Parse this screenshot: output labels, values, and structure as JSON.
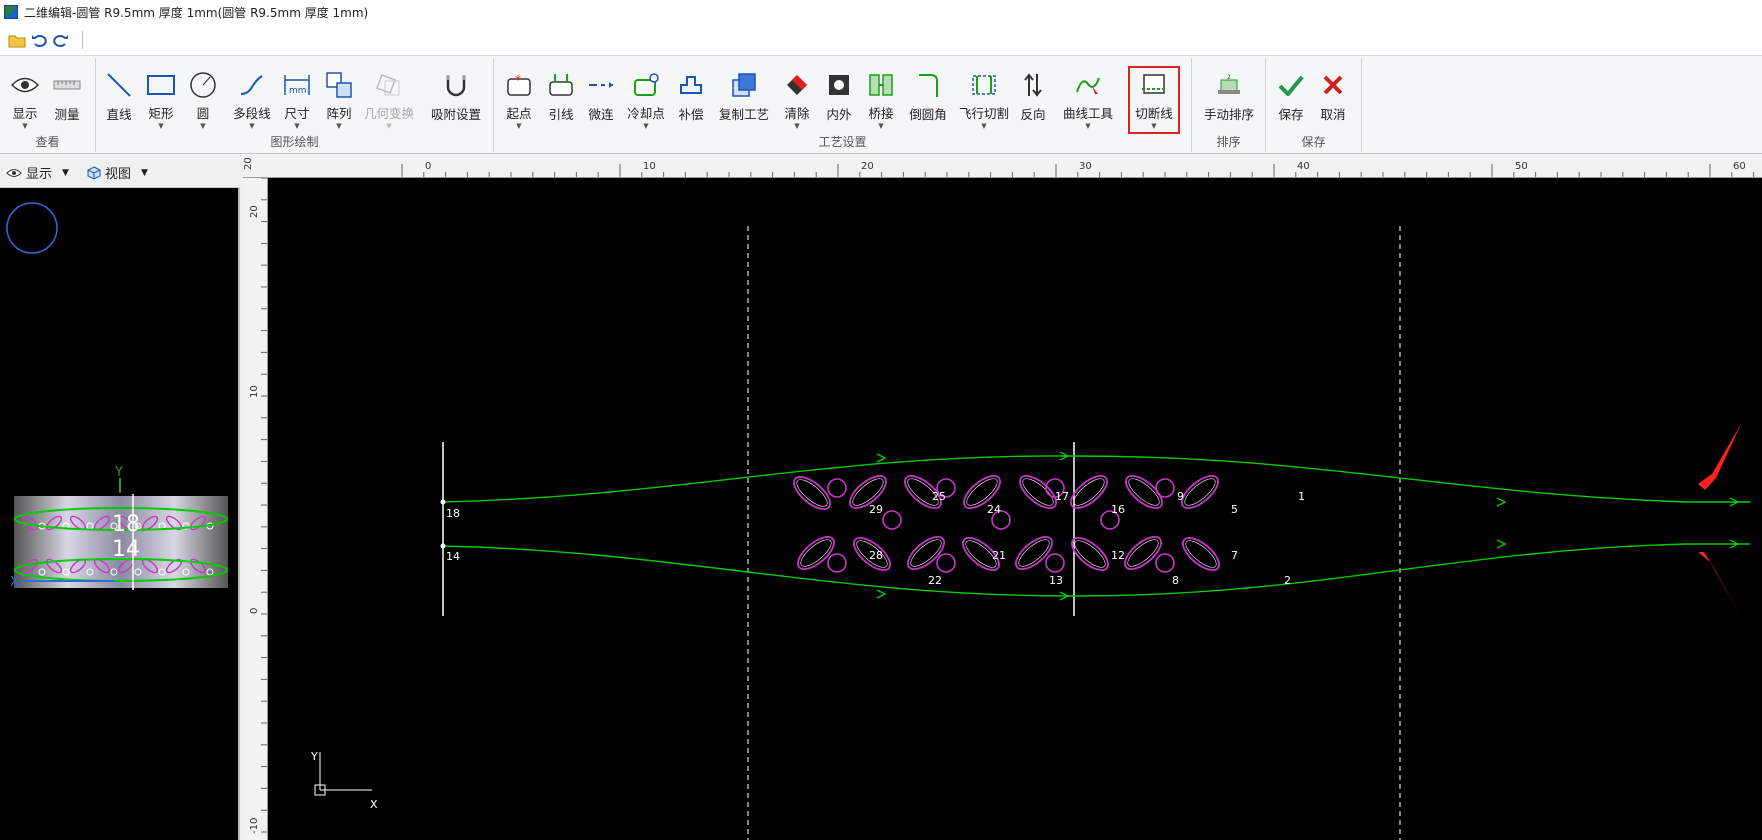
{
  "window": {
    "title": "二维编辑-圆管 R9.5mm 厚度 1mm(圆管 R9.5mm 厚度 1mm)"
  },
  "quick_access": {
    "icons": [
      "open-folder-icon",
      "undo-icon",
      "redo-icon"
    ]
  },
  "ribbon": {
    "groups": [
      {
        "label": "查看",
        "buttons": [
          {
            "label": "显示",
            "icon": "eye-icon"
          },
          {
            "label": "测量",
            "icon": "ruler-icon"
          }
        ]
      },
      {
        "label": "图形绘制",
        "buttons": [
          {
            "label": "直线",
            "icon": "line-icon"
          },
          {
            "label": "矩形",
            "icon": "rectangle-icon"
          },
          {
            "label": "圆",
            "icon": "circle-icon"
          },
          {
            "label": "多段线",
            "icon": "polyline-icon"
          },
          {
            "label": "尺寸",
            "icon": "dimension-icon"
          },
          {
            "label": "阵列",
            "icon": "array-icon"
          },
          {
            "label": "几何变换",
            "icon": "transform-icon",
            "disabled": true
          },
          {
            "label": "吸附设置",
            "icon": "snap-icon"
          }
        ]
      },
      {
        "label": "工艺设置",
        "buttons": [
          {
            "label": "起点",
            "icon": "start-point-icon"
          },
          {
            "label": "引线",
            "icon": "lead-line-icon"
          },
          {
            "label": "微连",
            "icon": "micro-joint-icon"
          },
          {
            "label": "冷却点",
            "icon": "cooling-point-icon"
          },
          {
            "label": "补偿",
            "icon": "compensation-icon"
          },
          {
            "label": "复制工艺",
            "icon": "copy-process-icon"
          },
          {
            "label": "清除",
            "icon": "clear-icon"
          },
          {
            "label": "内外",
            "icon": "inner-outer-icon"
          },
          {
            "label": "桥接",
            "icon": "bridge-icon"
          },
          {
            "label": "倒圆角",
            "icon": "fillet-icon"
          },
          {
            "label": "飞行切割",
            "icon": "flying-cut-icon"
          },
          {
            "label": "反向",
            "icon": "reverse-icon"
          },
          {
            "label": "曲线工具",
            "icon": "curve-tool-icon"
          },
          {
            "label": "切断线",
            "icon": "cut-off-line-icon"
          }
        ]
      },
      {
        "label": "排序",
        "buttons": [
          {
            "label": "手动排序",
            "icon": "manual-sort-icon"
          }
        ]
      },
      {
        "label": "保存",
        "buttons": [
          {
            "label": "保存",
            "icon": "check-icon"
          },
          {
            "label": "取消",
            "icon": "cancel-icon"
          }
        ]
      }
    ]
  },
  "left_panel": {
    "display_label": "显示",
    "view_label": "视图",
    "thumb_labels": [
      "18",
      "14"
    ],
    "axis_y": "Y",
    "axis_x": "X"
  },
  "canvas": {
    "ruler_top": [
      "20",
      "0",
      "10",
      "20",
      "30",
      "40",
      "50",
      "60"
    ],
    "ruler_left": [
      "20",
      "10",
      "0",
      "-10"
    ],
    "axis_y": "Y",
    "axis_x": "X",
    "start_labels": [
      "18",
      "14"
    ],
    "part_numbers_top": [
      "29",
      "25",
      "24",
      "17",
      "16",
      "9",
      "5",
      "1"
    ],
    "part_numbers_bottom": [
      "28",
      "22",
      "21",
      "13",
      "12",
      "8",
      "7",
      "2"
    ],
    "colors": {
      "contour": "#cc33cc",
      "path": "#00cc00",
      "annotation": "#ff2020"
    }
  }
}
